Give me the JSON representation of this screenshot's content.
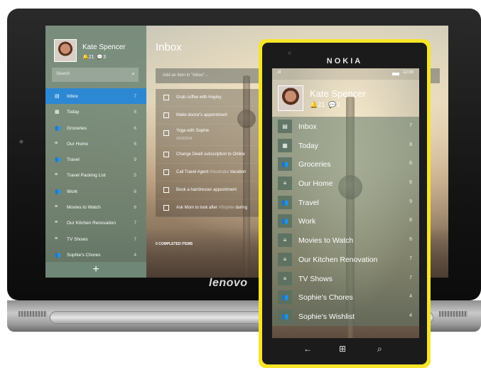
{
  "devices": {
    "tablet_brand": "lenovo",
    "phone_brand": "NOKIA"
  },
  "tablet": {
    "user": {
      "name": "Kate Spencer",
      "alerts": "21",
      "comments": "3"
    },
    "search_placeholder": "Search",
    "lists": [
      {
        "icon": "inbox-icon",
        "glyph": "▤",
        "label": "Inbox",
        "count": "7",
        "selected": true
      },
      {
        "icon": "calendar-icon",
        "glyph": "▦",
        "label": "Today",
        "count": "8"
      },
      {
        "icon": "shared-list-icon",
        "glyph": "👥",
        "label": "Groceries",
        "count": "6"
      },
      {
        "icon": "list-icon",
        "glyph": "≡",
        "label": "Our Home",
        "count": "6"
      },
      {
        "icon": "shared-list-icon",
        "glyph": "👥",
        "label": "Travel",
        "count": "9"
      },
      {
        "icon": "list-icon",
        "glyph": "≡",
        "label": "Travel Packing List",
        "count": "5"
      },
      {
        "icon": "shared-list-icon",
        "glyph": "👥",
        "label": "Work",
        "count": "8"
      },
      {
        "icon": "list-icon",
        "glyph": "≡",
        "label": "Movies to Watch",
        "count": "6"
      },
      {
        "icon": "list-icon",
        "glyph": "≡",
        "label": "Our Kitchen Renovation",
        "count": "7"
      },
      {
        "icon": "list-icon",
        "glyph": "≡",
        "label": "TV Shows",
        "count": "7"
      },
      {
        "icon": "shared-list-icon",
        "glyph": "👥",
        "label": "Sophie's Chores",
        "count": "4"
      }
    ],
    "main": {
      "title": "Inbox",
      "add_item_placeholder": "Add an item in \"Inbox\"...",
      "tasks": [
        {
          "title": "Grab coffee with Hayley"
        },
        {
          "title": "Make doctor's appointment"
        },
        {
          "title": "Yoga with Sophie",
          "date": "3/10/2014"
        },
        {
          "title": "Change Dwell subscription to Online"
        },
        {
          "title_pre": "Call Travel Agent ",
          "hashtag": "#Australia",
          "title_post": " Vacation"
        },
        {
          "title": "Book a hairdresser appointment"
        },
        {
          "title_pre": "Ask Mom to look after ",
          "hashtag": "#Sophie",
          "title_post": " during"
        }
      ],
      "completed_label": "0 COMPLETED ITEMS"
    }
  },
  "phone": {
    "status": {
      "time": "12:00",
      "signal": ".ıll"
    },
    "user": {
      "name": "Kate Spencer",
      "alerts": "21",
      "comments": "3"
    },
    "lists": [
      {
        "icon": "inbox-icon",
        "glyph": "▤",
        "label": "Inbox",
        "count": "7"
      },
      {
        "icon": "calendar-icon",
        "glyph": "▦",
        "label": "Today",
        "count": "8"
      },
      {
        "icon": "shared-list-icon",
        "glyph": "👥",
        "label": "Groceries",
        "count": "6"
      },
      {
        "icon": "list-icon",
        "glyph": "≡",
        "label": "Our Home",
        "count": "6"
      },
      {
        "icon": "shared-list-icon",
        "glyph": "👥",
        "label": "Travel",
        "count": "9"
      },
      {
        "icon": "shared-list-icon",
        "glyph": "👥",
        "label": "Work",
        "count": "8"
      },
      {
        "icon": "list-icon",
        "glyph": "≡",
        "label": "Movies to Watch",
        "count": "6"
      },
      {
        "icon": "list-icon",
        "glyph": "≡",
        "label": "Our Kitchen Renovation",
        "count": "7"
      },
      {
        "icon": "list-icon",
        "glyph": "≡",
        "label": "TV Shows",
        "count": "7"
      },
      {
        "icon": "shared-list-icon",
        "glyph": "👥",
        "label": "Sophie's Chores",
        "count": "4"
      },
      {
        "icon": "shared-list-icon",
        "glyph": "👥",
        "label": "Sophie's Wishlist",
        "count": "4"
      }
    ],
    "add_glyph": "+",
    "more_glyph": "···",
    "nav": {
      "back": "←",
      "start": "⊞",
      "search": "⌕"
    }
  },
  "colors": {
    "sidebar": "#688070",
    "selected": "#2d88d4",
    "phone_body": "#f6e529"
  }
}
